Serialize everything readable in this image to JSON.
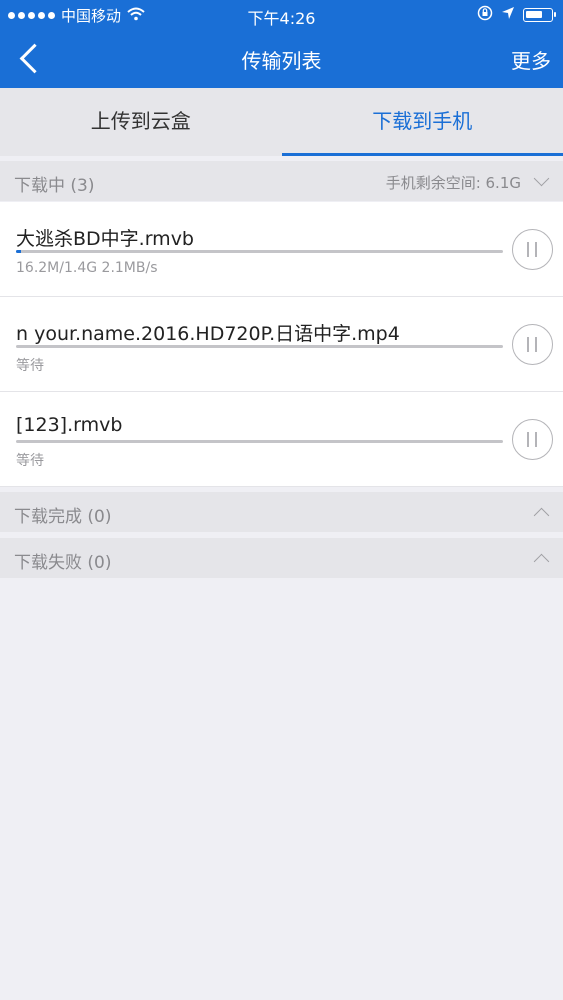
{
  "status_bar": {
    "carrier": "中国移动",
    "time": "下午4:26"
  },
  "nav": {
    "title": "传输列表",
    "more_label": "更多"
  },
  "tabs": [
    {
      "label": "上传到云盒",
      "active": false
    },
    {
      "label": "下载到手机",
      "active": true
    }
  ],
  "downloading": {
    "label": "下载中 (3)",
    "space_label": "手机剩余空间: 6.1G"
  },
  "items": [
    {
      "name": "大逃杀BD中字.rmvb",
      "meta": "16.2M/1.4G  2.1MB/s",
      "progress": 0.011
    },
    {
      "name": "n your.name.2016.HD720P.日语中字.mp4",
      "meta": "等待",
      "progress": 0
    },
    {
      "name": "[123].rmvb",
      "meta": "等待",
      "progress": 0
    }
  ],
  "completed": {
    "label": "下载完成 (0)"
  },
  "failed": {
    "label": "下载失败 (0)"
  },
  "colors": {
    "accent": "#1a6fd6",
    "header_bg": "#1a6fd6",
    "background": "#efeff4"
  }
}
